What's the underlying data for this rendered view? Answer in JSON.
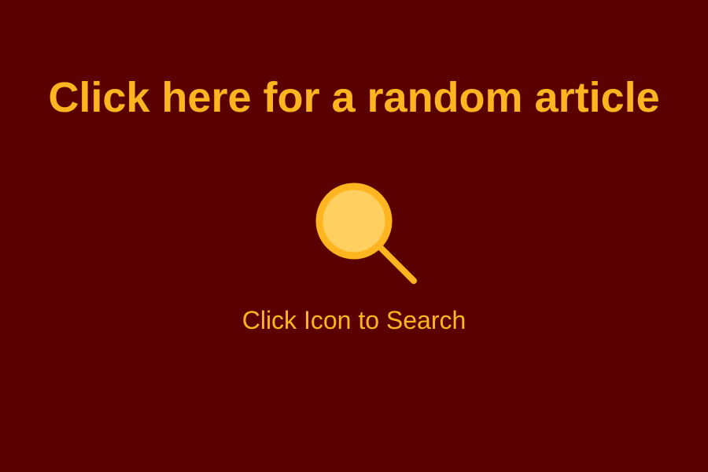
{
  "random_article": {
    "label": "Click here for a random article"
  },
  "search": {
    "caption": "Click Icon to Search",
    "icon": "search-icon"
  },
  "colors": {
    "background": "#5a0000",
    "accent": "#ffb51f",
    "lens_fill": "#ffd060"
  }
}
